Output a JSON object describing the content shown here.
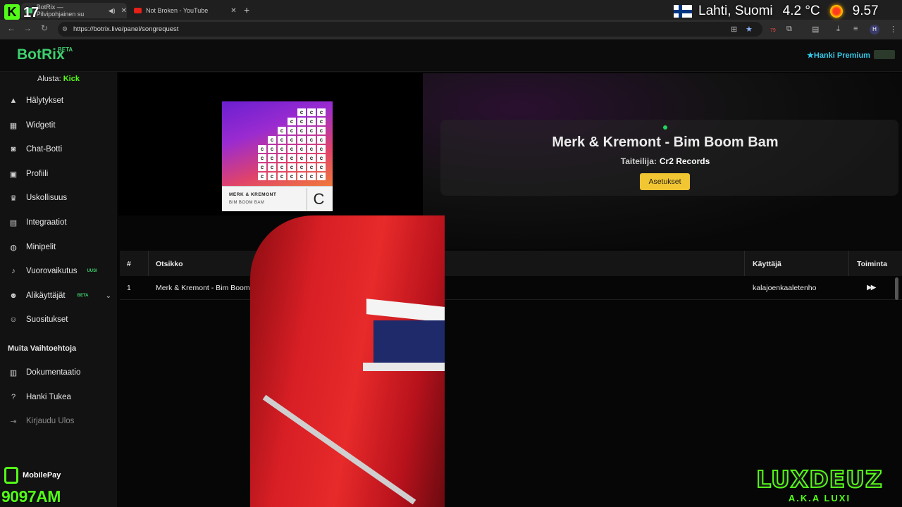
{
  "overlay": {
    "kick_letter": "K",
    "kick_count": "17",
    "weather_location": "Lahti, Suomi",
    "weather_temp": "4.2 °C",
    "time": "9.57",
    "mobilepay_label": "MobilePay",
    "mobilepay_number": "9097AM",
    "streamer_name": "LUXDEUZ",
    "streamer_aka": "A.K.A LUXI"
  },
  "browser": {
    "tabs": [
      {
        "title": "BotRix — Pilvipohjainen su",
        "close": "✕"
      },
      {
        "title": "Not Broken - YouTube",
        "close": "✕"
      }
    ],
    "new_tab": "+",
    "url": "https://botrix.live/panel/songrequest",
    "extension_badge": "79",
    "profile_initial": "H"
  },
  "header": {
    "logo": "BotRix",
    "logo_badge": "BETA",
    "premium": "Hanki Premium"
  },
  "sidebar": {
    "platform_label": "Alusta:",
    "platform_value": "Kick",
    "items": [
      {
        "label": "Hälytykset",
        "icon": "warning-icon"
      },
      {
        "label": "Widgetit",
        "icon": "grid-icon"
      },
      {
        "label": "Chat-Botti",
        "icon": "robot-icon"
      },
      {
        "label": "Profiili",
        "icon": "id-card-icon"
      },
      {
        "label": "Uskollisuus",
        "icon": "trophy-icon"
      },
      {
        "label": "Integraatiot",
        "icon": "plug-icon"
      },
      {
        "label": "Minipelit",
        "icon": "gamepad-icon"
      },
      {
        "label": "Vuorovaikutus",
        "icon": "music-icon",
        "badge": "UUSI"
      },
      {
        "label": "Alikäyttäjät",
        "icon": "users-icon",
        "badge": "BETA"
      },
      {
        "label": "Suositukset",
        "icon": "people-icon"
      }
    ],
    "section_title": "Muita Vaihtoehtoja",
    "extra_items": [
      {
        "label": "Dokumentaatio",
        "icon": "document-icon"
      },
      {
        "label": "Hanki Tukea",
        "icon": "help-icon"
      },
      {
        "label": "Kirjaudu Ulos",
        "icon": "logout-icon"
      }
    ]
  },
  "now_playing": {
    "title": "Merk & Kremont - Bim Boom Bam",
    "artist_label": "Taiteilija:",
    "artist": "Cr2 Records",
    "settings_button": "Asetukset",
    "cover_artist": "MERK & KREMONT",
    "cover_song": "BIM BOOM BAM",
    "cover_logo": "C"
  },
  "queue": {
    "headers": [
      "#",
      "Otsikko",
      "Käyttäjä",
      "Toiminta"
    ],
    "rows": [
      {
        "num": "1",
        "title": "Merk & Kremont - Bim Boom Bam",
        "user": "kalajoenkaaletenho",
        "action": "▶▶"
      }
    ]
  },
  "colors": {
    "brand_green": "#3ecf6e",
    "kick_green": "#53fc18",
    "premium_blue": "#34c9e8",
    "settings_yellow": "#f2c532"
  }
}
